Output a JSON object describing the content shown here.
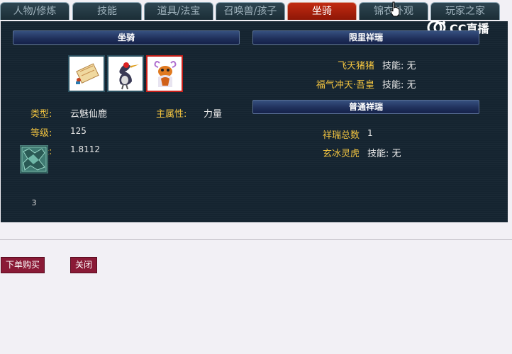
{
  "tabs": [
    {
      "label": "人物/修炼"
    },
    {
      "label": "技能"
    },
    {
      "label": "道具/法宝"
    },
    {
      "label": "召唤兽/孩子"
    },
    {
      "label": "坐骑"
    },
    {
      "label": "锦衣外观"
    },
    {
      "label": "玩家之家"
    }
  ],
  "active_tab": "坐骑",
  "watermark": {
    "text": "CC直播"
  },
  "mount": {
    "header": "坐骑",
    "slots": [
      {
        "name": "scroll"
      },
      {
        "name": "crane"
      },
      {
        "name": "deer"
      }
    ],
    "selected_slot": 2,
    "type_label": "类型:",
    "type_value": "云魅仙鹿",
    "attr_label": "主属性:",
    "attr_value": "力量",
    "level_label": "等级:",
    "level_value": "125",
    "growth_label": "成长:",
    "growth_value": "1.8112",
    "item_count": "3"
  },
  "limited": {
    "header": "限里祥瑞",
    "items": [
      {
        "name": "飞天猪猪",
        "skill": "技能:  无"
      },
      {
        "name": "福气冲天·吾皇",
        "skill": "技能:  无"
      }
    ]
  },
  "common": {
    "header": "普通祥瑞",
    "total_label": "祥瑞总数",
    "total_value": "1",
    "items": [
      {
        "name": "玄冰灵虎",
        "skill": "技能:  无"
      }
    ]
  },
  "footer": {
    "buy_label": "下单购买",
    "close_label": "关闭"
  },
  "colors": {
    "panel_bg": "#152430",
    "active_tab": "#b3200a",
    "label_gold": "#f2c440",
    "button": "#8a1a36"
  }
}
